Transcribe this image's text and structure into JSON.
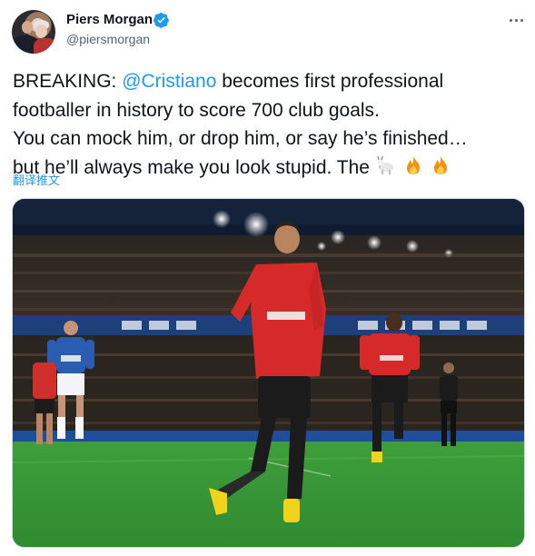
{
  "author": {
    "display_name": "Piers Morgan",
    "handle": "@piersmorgan",
    "verified": true
  },
  "tweet": {
    "prefix": "BREAKING: ",
    "mention": "@Cristiano",
    "line1_rest": " becomes first professional",
    "line2": "footballer in history to score 700 club goals.",
    "line3": "You can mock him, or drop him, or say he’s finished…",
    "line4": "but he’ll always make you look stupid. The ",
    "emojis": [
      "goat-emoji",
      "fire-emoji",
      "fire-emoji"
    ]
  },
  "translate_label": "翻译推文",
  "photo": {
    "shirt_sponsor": "TeamViewer",
    "opponent_sponsor": "Stake"
  },
  "colors": {
    "accent": "#1d9bf0",
    "text": "#0f1419",
    "secondary": "#536471",
    "verified": "#1d9bf0",
    "united_red": "#d62a2a",
    "everton_blue": "#2a5db0",
    "pitch": "#3e9a3a"
  }
}
